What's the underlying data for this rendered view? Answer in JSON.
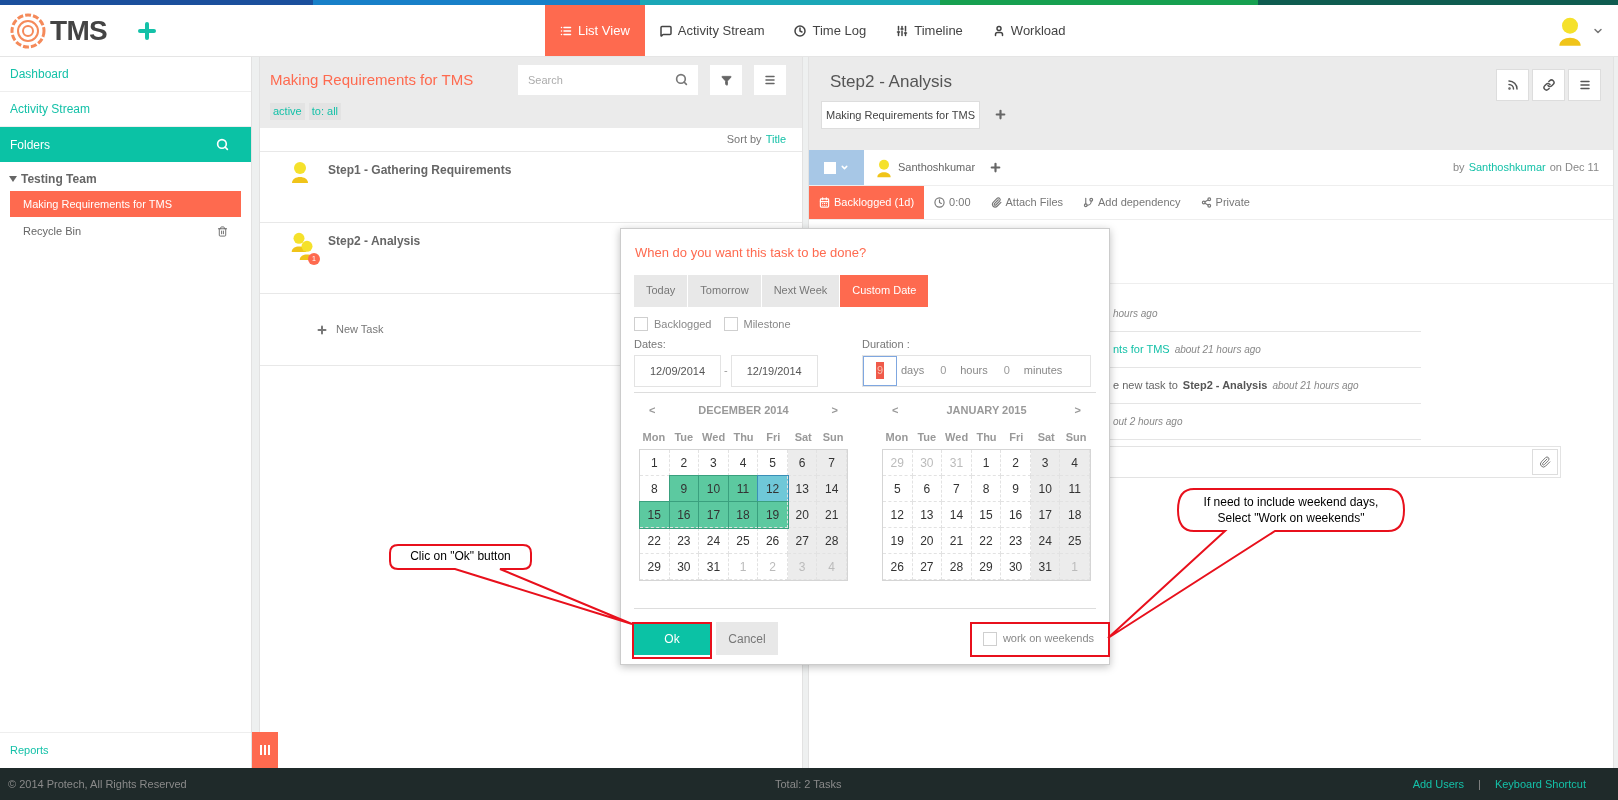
{
  "header": {
    "logo": "TMS",
    "nav": [
      {
        "label": "List View",
        "selected": true
      },
      {
        "label": "Activity Stream",
        "selected": false
      },
      {
        "label": "Time Log",
        "selected": false
      },
      {
        "label": "Timeline",
        "selected": false
      },
      {
        "label": "Workload",
        "selected": false
      }
    ]
  },
  "sidebar": {
    "items": [
      "Dashboard",
      "Activity Stream"
    ],
    "folders_label": "Folders",
    "tree": [
      {
        "label": "Testing Team",
        "expanded": true,
        "children": [
          {
            "label": "Making Requirements for TMS",
            "selected": true,
            "kind": "folder"
          },
          {
            "label": "Recycle Bin",
            "selected": false,
            "kind": "trash"
          }
        ]
      }
    ],
    "footer_link": "Reports"
  },
  "list_panel": {
    "title": "Making Requirements for TMS",
    "search": {
      "placeholder": "Search"
    },
    "tags": [
      "active",
      "to: all"
    ],
    "sort_label": "Sort by",
    "sort_value": "Title",
    "tasks": [
      {
        "title": "Step1 - Gathering Requirements",
        "kind": "single"
      },
      {
        "title": "Step2 - Analysis",
        "kind": "group",
        "badge": "1"
      }
    ],
    "new_task": "New Task"
  },
  "task_detail": {
    "title": "Step2 - Analysis",
    "folder_chip": "Making Requirements for TMS",
    "assignee": "Santhoshkumar",
    "created_prefix": "by",
    "created_by": "Santhoshkumar",
    "created_suffix": "on Dec 11",
    "actions": [
      {
        "label": "Backlogged (1d)",
        "active": true
      },
      {
        "label": "0:00",
        "active": false
      },
      {
        "label": "Attach Files",
        "active": false
      },
      {
        "label": "Add dependency",
        "active": false
      },
      {
        "label": "Private",
        "active": false
      }
    ],
    "activity": [
      [
        {
          "text": "hours ago",
          "kind": "time"
        }
      ],
      [
        {
          "text": "nts for TMS",
          "kind": "link"
        },
        {
          "text": "about 21 hours ago",
          "kind": "time"
        }
      ],
      [
        {
          "text": "e new task to",
          "kind": "plain"
        },
        {
          "text": "Step2 - Analysis",
          "kind": "bold"
        },
        {
          "text": "about 21 hours ago",
          "kind": "time"
        }
      ],
      [
        {
          "text": "out 2 hours ago",
          "kind": "time"
        }
      ]
    ]
  },
  "date_dialog": {
    "question": "When do you want this task to be done?",
    "presets": [
      {
        "label": "Today",
        "selected": false
      },
      {
        "label": "Tomorrow",
        "selected": false
      },
      {
        "label": "Next Week",
        "selected": false
      },
      {
        "label": "Custom Date",
        "selected": true
      }
    ],
    "options": [
      {
        "label": "Backlogged",
        "checked": false
      },
      {
        "label": "Milestone",
        "checked": false
      }
    ],
    "dates_label": "Dates:",
    "start": "12/09/2014",
    "separator": "-",
    "end": "12/19/2014",
    "duration_label": "Duration :",
    "duration": [
      {
        "value": "9",
        "unit": "days",
        "focused": true
      },
      {
        "value": "0",
        "unit": "hours",
        "focused": false
      },
      {
        "value": "0",
        "unit": "minutes",
        "focused": false
      }
    ],
    "calendars": [
      {
        "title": "DECEMBER 2014",
        "prev": "<",
        "next": ">",
        "weekdays": [
          "Mon",
          "Tue",
          "Wed",
          "Thu",
          "Fri",
          "Sat",
          "Sun"
        ],
        "weeks": [
          [
            {
              "day": "1",
              "muted": false,
              "range": false,
              "today": false
            },
            {
              "day": "2",
              "muted": false,
              "range": false,
              "today": false
            },
            {
              "day": "3",
              "muted": false,
              "range": false,
              "today": false
            },
            {
              "day": "4",
              "muted": false,
              "range": false,
              "today": false
            },
            {
              "day": "5",
              "muted": false,
              "range": false,
              "today": false
            },
            {
              "day": "6",
              "muted": false,
              "range": false,
              "today": false
            },
            {
              "day": "7",
              "muted": false,
              "range": false,
              "today": false
            }
          ],
          [
            {
              "day": "8",
              "muted": false,
              "range": false,
              "today": false
            },
            {
              "day": "9",
              "muted": false,
              "range": true,
              "today": false
            },
            {
              "day": "10",
              "muted": false,
              "range": true,
              "today": false
            },
            {
              "day": "11",
              "muted": false,
              "range": true,
              "today": false
            },
            {
              "day": "12",
              "muted": false,
              "range": false,
              "today": true
            },
            {
              "day": "13",
              "muted": false,
              "range": false,
              "today": false
            },
            {
              "day": "14",
              "muted": false,
              "range": false,
              "today": false
            }
          ],
          [
            {
              "day": "15",
              "muted": false,
              "range": true,
              "today": false
            },
            {
              "day": "16",
              "muted": false,
              "range": true,
              "today": false
            },
            {
              "day": "17",
              "muted": false,
              "range": true,
              "today": false
            },
            {
              "day": "18",
              "muted": false,
              "range": true,
              "today": false
            },
            {
              "day": "19",
              "muted": false,
              "range": true,
              "today": false
            },
            {
              "day": "20",
              "muted": false,
              "range": false,
              "today": false
            },
            {
              "day": "21",
              "muted": false,
              "range": false,
              "today": false
            }
          ],
          [
            {
              "day": "22",
              "muted": false,
              "range": false,
              "today": false
            },
            {
              "day": "23",
              "muted": false,
              "range": false,
              "today": false
            },
            {
              "day": "24",
              "muted": false,
              "range": false,
              "today": false
            },
            {
              "day": "25",
              "muted": false,
              "range": false,
              "today": false
            },
            {
              "day": "26",
              "muted": false,
              "range": false,
              "today": false
            },
            {
              "day": "27",
              "muted": false,
              "range": false,
              "today": false
            },
            {
              "day": "28",
              "muted": false,
              "range": false,
              "today": false
            }
          ],
          [
            {
              "day": "29",
              "muted": false,
              "range": false,
              "today": false
            },
            {
              "day": "30",
              "muted": false,
              "range": false,
              "today": false
            },
            {
              "day": "31",
              "muted": false,
              "range": false,
              "today": false
            },
            {
              "day": "1",
              "muted": true,
              "range": false,
              "today": false
            },
            {
              "day": "2",
              "muted": true,
              "range": false,
              "today": false
            },
            {
              "day": "3",
              "muted": true,
              "range": false,
              "today": false
            },
            {
              "day": "4",
              "muted": true,
              "range": false,
              "today": false
            }
          ]
        ]
      },
      {
        "title": "JANUARY 2015",
        "prev": "<",
        "next": ">",
        "weekdays": [
          "Mon",
          "Tue",
          "Wed",
          "Thu",
          "Fri",
          "Sat",
          "Sun"
        ],
        "weeks": [
          [
            {
              "day": "29",
              "muted": true,
              "range": false,
              "today": false
            },
            {
              "day": "30",
              "muted": true,
              "range": false,
              "today": false
            },
            {
              "day": "31",
              "muted": true,
              "range": false,
              "today": false
            },
            {
              "day": "1",
              "muted": false,
              "range": false,
              "today": false
            },
            {
              "day": "2",
              "muted": false,
              "range": false,
              "today": false
            },
            {
              "day": "3",
              "muted": false,
              "range": false,
              "today": false
            },
            {
              "day": "4",
              "muted": false,
              "range": false,
              "today": false
            }
          ],
          [
            {
              "day": "5",
              "muted": false,
              "range": false,
              "today": false
            },
            {
              "day": "6",
              "muted": false,
              "range": false,
              "today": false
            },
            {
              "day": "7",
              "muted": false,
              "range": false,
              "today": false
            },
            {
              "day": "8",
              "muted": false,
              "range": false,
              "today": false
            },
            {
              "day": "9",
              "muted": false,
              "range": false,
              "today": false
            },
            {
              "day": "10",
              "muted": false,
              "range": false,
              "today": false
            },
            {
              "day": "11",
              "muted": false,
              "range": false,
              "today": false
            }
          ],
          [
            {
              "day": "12",
              "muted": false,
              "range": false,
              "today": false
            },
            {
              "day": "13",
              "muted": false,
              "range": false,
              "today": false
            },
            {
              "day": "14",
              "muted": false,
              "range": false,
              "today": false
            },
            {
              "day": "15",
              "muted": false,
              "range": false,
              "today": false
            },
            {
              "day": "16",
              "muted": false,
              "range": false,
              "today": false
            },
            {
              "day": "17",
              "muted": false,
              "range": false,
              "today": false
            },
            {
              "day": "18",
              "muted": false,
              "range": false,
              "today": false
            }
          ],
          [
            {
              "day": "19",
              "muted": false,
              "range": false,
              "today": false
            },
            {
              "day": "20",
              "muted": false,
              "range": false,
              "today": false
            },
            {
              "day": "21",
              "muted": false,
              "range": false,
              "today": false
            },
            {
              "day": "22",
              "muted": false,
              "range": false,
              "today": false
            },
            {
              "day": "23",
              "muted": false,
              "range": false,
              "today": false
            },
            {
              "day": "24",
              "muted": false,
              "range": false,
              "today": false
            },
            {
              "day": "25",
              "muted": false,
              "range": false,
              "today": false
            }
          ],
          [
            {
              "day": "26",
              "muted": false,
              "range": false,
              "today": false
            },
            {
              "day": "27",
              "muted": false,
              "range": false,
              "today": false
            },
            {
              "day": "28",
              "muted": false,
              "range": false,
              "today": false
            },
            {
              "day": "29",
              "muted": false,
              "range": false,
              "today": false
            },
            {
              "day": "30",
              "muted": false,
              "range": false,
              "today": false
            },
            {
              "day": "31",
              "muted": false,
              "range": false,
              "today": false
            },
            {
              "day": "1",
              "muted": true,
              "range": false,
              "today": false
            }
          ]
        ]
      }
    ],
    "ok": "Ok",
    "cancel": "Cancel",
    "weekends": {
      "label": "work on weekends",
      "checked": false
    }
  },
  "callouts": [
    {
      "text": "Clic on \"Ok\" button"
    },
    {
      "text": "If need to include weekend days, Select \"Work on weekends\""
    }
  ],
  "footer": {
    "copyright": "© 2014 Protech, All Rights Reserved",
    "total": "Total: 2 Tasks",
    "links": [
      "Add Users",
      "Keyboard Shortcut"
    ],
    "separator": "|"
  }
}
